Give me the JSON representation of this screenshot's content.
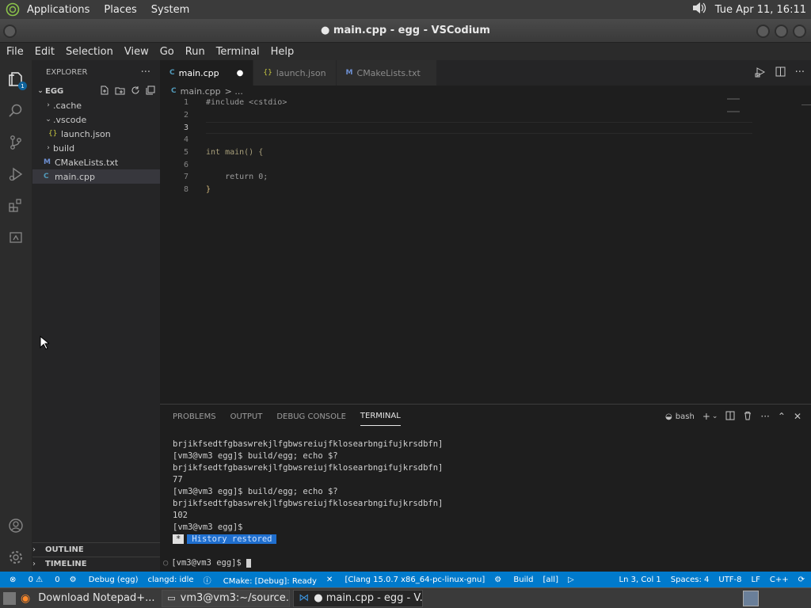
{
  "topbar": {
    "menus": [
      "Applications",
      "Places",
      "System"
    ],
    "clock": "Tue Apr 11, 16:11"
  },
  "window": {
    "title": "● main.cpp - egg - VSCodium"
  },
  "menubar": [
    "File",
    "Edit",
    "Selection",
    "View",
    "Go",
    "Run",
    "Terminal",
    "Help"
  ],
  "activity": {
    "badge": "1"
  },
  "explorer": {
    "header": "EXPLORER",
    "folder": "EGG",
    "items": [
      {
        "label": ".cache",
        "chev": ">"
      },
      {
        "label": ".vscode",
        "chev": "v"
      },
      {
        "label": "launch.json",
        "icon": "{}"
      },
      {
        "label": "build",
        "chev": ">"
      },
      {
        "label": "CMakeLists.txt",
        "icon": "M"
      },
      {
        "label": "main.cpp",
        "icon": "C"
      }
    ],
    "outline": "OUTLINE",
    "timeline": "TIMELINE"
  },
  "tabs": [
    {
      "label": "main.cpp",
      "dirty": "●"
    },
    {
      "label": "launch.json"
    },
    {
      "label": "CMakeLists.txt"
    }
  ],
  "breadcrumb": {
    "file": "main.cpp",
    "rest": "> ..."
  },
  "code": {
    "lines": [
      {
        "n": "1",
        "text": "#include <cstdio>"
      },
      {
        "n": "2",
        "text": ""
      },
      {
        "n": "3",
        "text": ""
      },
      {
        "n": "4",
        "text": ""
      },
      {
        "n": "5",
        "text": "int main() {"
      },
      {
        "n": "6",
        "text": ""
      },
      {
        "n": "7",
        "text": "    return 0;"
      },
      {
        "n": "8",
        "text": "}"
      }
    ]
  },
  "panel": {
    "tabs": [
      "PROBLEMS",
      "OUTPUT",
      "DEBUG CONSOLE",
      "TERMINAL"
    ],
    "shell": "bash",
    "terminal": [
      "brjikfsedtfgbaswrekjlfgbwsreiujfklosearbngifujkrsdbfn]",
      "[vm3@vm3 egg]$ build/egg; echo $?",
      "brjikfsedtfgbaswrekjlfgbwsreiujfklosearbngifujkrsdbfn]",
      "77",
      "[vm3@vm3 egg]$ build/egg; echo $?",
      "brjikfsedtfgbaswrekjlfgbwsreiujfklosearbngifujkrsdbfn]",
      "102",
      "[vm3@vm3 egg]$ "
    ],
    "history_star": "*",
    "history": "History restored",
    "prompt": "[vm3@vm3 egg]$ "
  },
  "status": {
    "errors": "0",
    "warnings": "0",
    "debug": "Debug (egg)",
    "clangd": "clangd: idle",
    "cmake": "CMake: [Debug]: Ready",
    "kit": "[Clang 15.0.7 x86_64-pc-linux-gnu]",
    "build": "Build",
    "target": "[all]",
    "position": "Ln 3, Col 1",
    "spaces": "Spaces: 4",
    "encoding": "UTF-8",
    "eol": "LF",
    "lang": "C++"
  },
  "taskbar": [
    {
      "label": "Download Notepad+..."
    },
    {
      "label": "vm3@vm3:~/source..."
    },
    {
      "label": "● main.cpp - egg - V..."
    }
  ]
}
